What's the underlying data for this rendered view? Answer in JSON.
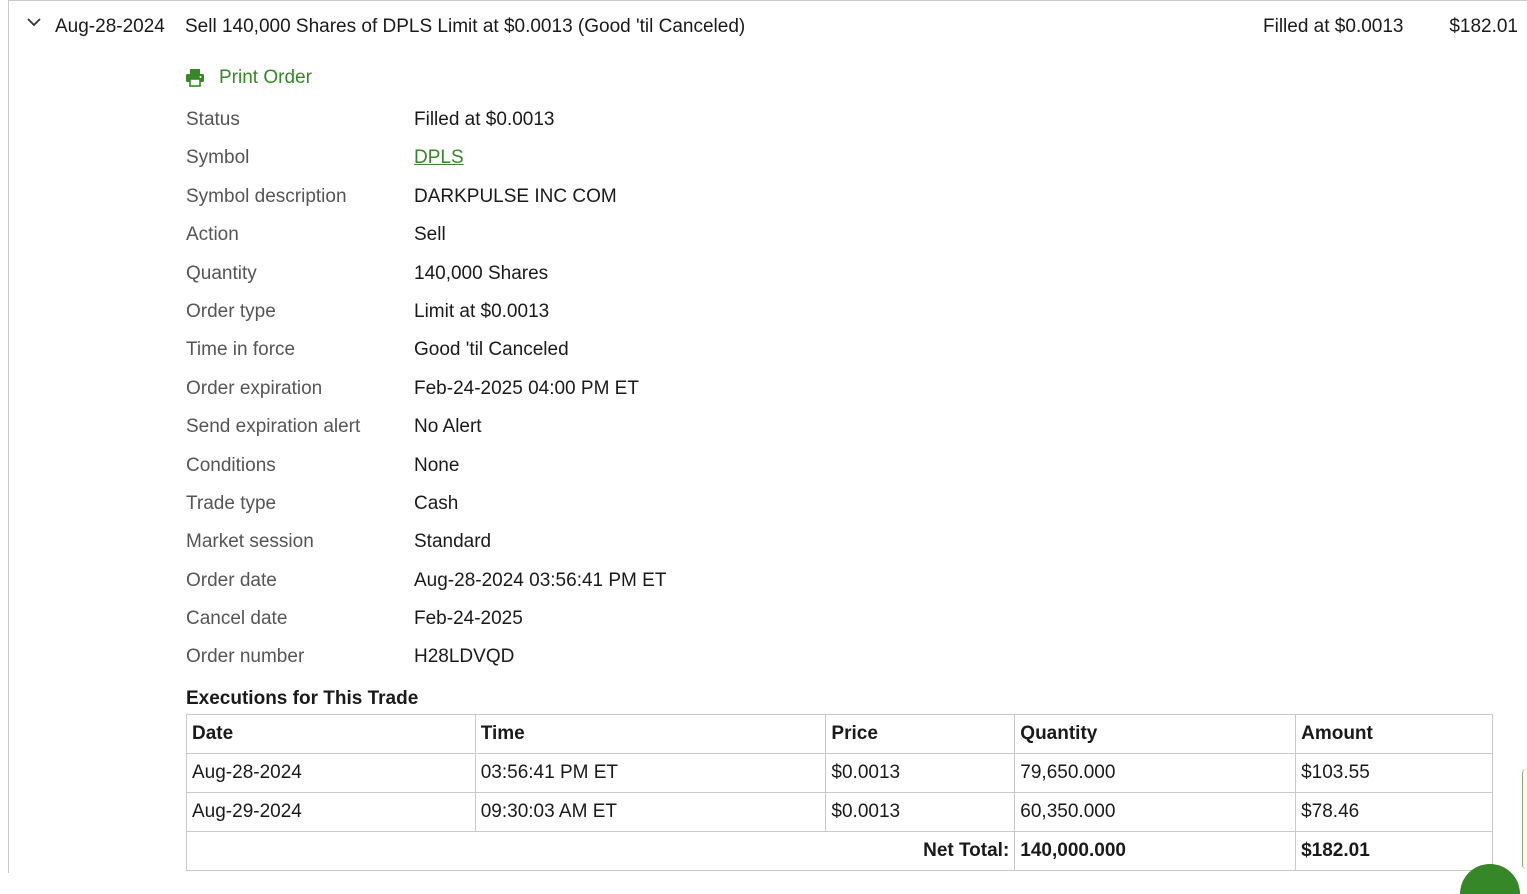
{
  "order_header": {
    "date": "Aug-28-2024",
    "description": "Sell 140,000 Shares of DPLS Limit at $0.0013 (Good 'til Canceled)",
    "status": "Filled at $0.0013",
    "amount": "$182.01"
  },
  "print_order_label": "Print Order",
  "details": [
    {
      "label": "Status",
      "value": "Filled at $0.0013"
    },
    {
      "label": "Symbol",
      "value": "DPLS"
    },
    {
      "label": "Symbol description",
      "value": "DARKPULSE INC COM"
    },
    {
      "label": "Action",
      "value": "Sell"
    },
    {
      "label": "Quantity",
      "value": "140,000 Shares"
    },
    {
      "label": "Order type",
      "value": "Limit at $0.0013"
    },
    {
      "label": "Time in force",
      "value": "Good 'til Canceled"
    },
    {
      "label": "Order expiration",
      "value": "Feb-24-2025 04:00 PM ET"
    },
    {
      "label": "Send expiration alert",
      "value": "No Alert"
    },
    {
      "label": "Conditions",
      "value": "None"
    },
    {
      "label": "Trade type",
      "value": "Cash"
    },
    {
      "label": "Market session",
      "value": "Standard"
    },
    {
      "label": "Order date",
      "value": "Aug-28-2024 03:56:41 PM ET"
    },
    {
      "label": "Cancel date",
      "value": "Feb-24-2025"
    },
    {
      "label": "Order number",
      "value": "H28LDVQD"
    }
  ],
  "executions": {
    "title": "Executions for This Trade",
    "columns": [
      "Date",
      "Time",
      "Price",
      "Quantity",
      "Amount"
    ],
    "rows": [
      [
        "Aug-28-2024",
        "03:56:41 PM ET",
        "$0.0013",
        "79,650.000",
        "$103.55"
      ],
      [
        "Aug-29-2024",
        "09:30:03 AM ET",
        "$0.0013",
        "60,350.000",
        "$78.46"
      ]
    ],
    "net_total_label": "Net Total:",
    "net_total_quantity": "140,000.000",
    "net_total_amount": "$182.01"
  },
  "colors": {
    "link_green": "#368727",
    "label_gray": "#555555",
    "border_gray": "#c9c9c9"
  }
}
